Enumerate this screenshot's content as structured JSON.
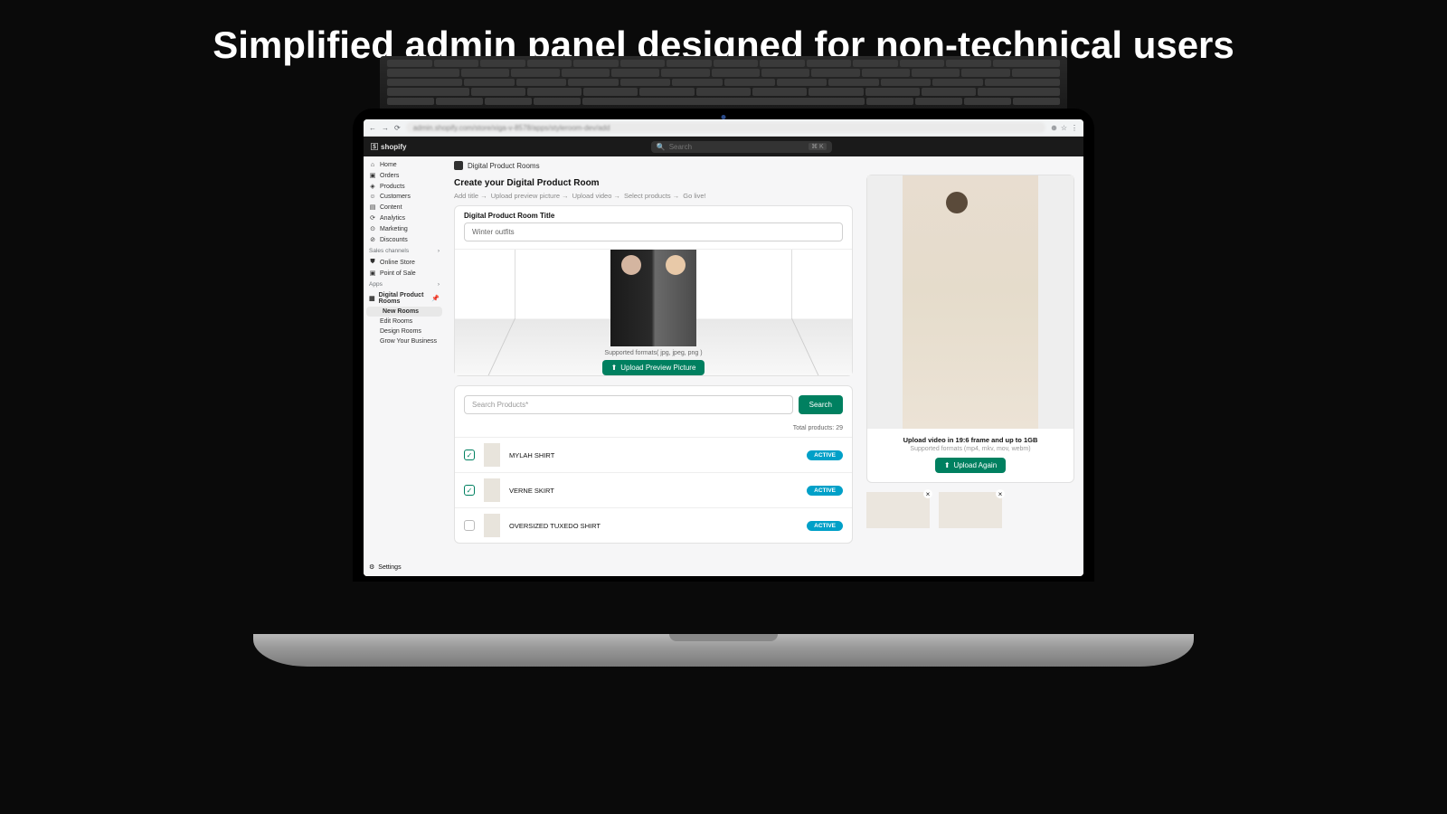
{
  "hero": "Simplified admin panel designed for non-technical users",
  "browser": {
    "url": "admin.shopify.com/store/xiga-v-8578/apps/styleroom-dev/add"
  },
  "header": {
    "brand": "shopify",
    "search_placeholder": "Search",
    "kbd": "⌘ K"
  },
  "sidebar": {
    "items": [
      {
        "icon": "⌂",
        "label": "Home"
      },
      {
        "icon": "▣",
        "label": "Orders"
      },
      {
        "icon": "◈",
        "label": "Products"
      },
      {
        "icon": "☺",
        "label": "Customers"
      },
      {
        "icon": "▤",
        "label": "Content"
      },
      {
        "icon": "⟳",
        "label": "Analytics"
      },
      {
        "icon": "⊙",
        "label": "Marketing"
      },
      {
        "icon": "⊘",
        "label": "Discounts"
      }
    ],
    "sales_header": "Sales channels",
    "sales": [
      {
        "icon": "⛊",
        "label": "Online Store"
      },
      {
        "icon": "▣",
        "label": "Point of Sale"
      }
    ],
    "apps_header": "Apps",
    "app": {
      "icon": "▦",
      "label": "Digital Product Rooms"
    },
    "subs": [
      {
        "label": "New Rooms",
        "active": true
      },
      {
        "label": "Edit Rooms"
      },
      {
        "label": "Design Rooms"
      },
      {
        "label": "Grow Your Business"
      }
    ],
    "settings": {
      "icon": "⚙",
      "label": "Settings"
    }
  },
  "crumb": "Digital Product Rooms",
  "page": {
    "title": "Create your Digital Product Room",
    "steps": [
      "Add title",
      "Upload preview picture",
      "Upload video",
      "Select products",
      "Go live!"
    ],
    "room_title_label": "Digital Product Room Title",
    "room_title_value": "Winter outfits",
    "formats": "Supported formats( jpg, jpeg, png )",
    "upload_btn": "Upload Preview Picture",
    "search_placeholder": "Search Products*",
    "search_btn": "Search",
    "total_label": "Total products:",
    "total": "29",
    "products": [
      {
        "name": "MYLAH SHIRT",
        "status": "ACTIVE",
        "checked": true
      },
      {
        "name": "VERNE SKIRT",
        "status": "ACTIVE",
        "checked": true
      },
      {
        "name": "OVERSIZED TUXEDO SHIRT",
        "status": "ACTIVE",
        "checked": false
      }
    ]
  },
  "video": {
    "headline": "Upload video in 19:6 frame and up to 1GB",
    "sub": "Supported formats (mp4, mkv, mov, webm)",
    "btn": "Upload Again"
  }
}
